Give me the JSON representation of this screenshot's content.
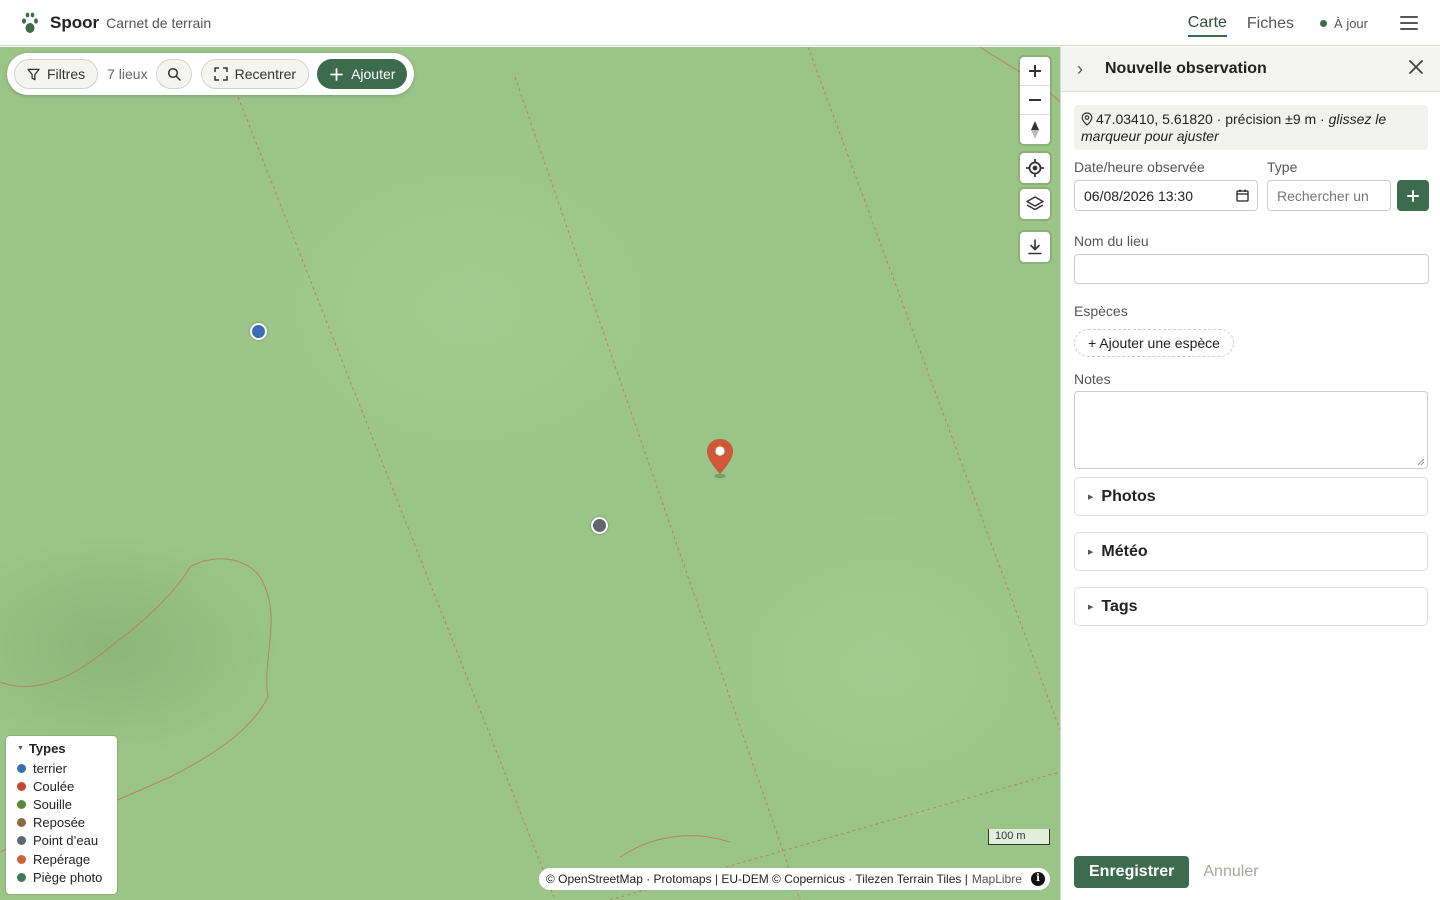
{
  "app": {
    "name": "Spoor",
    "subtitle": "Carnet de terrain"
  },
  "nav": {
    "tabs": [
      "Carte",
      "Fiches"
    ],
    "active_tab": "Carte",
    "status": "À jour"
  },
  "toolbar": {
    "filters_label": "Filtres",
    "places_count": "7 lieux",
    "recenter_label": "Recentrer",
    "add_label": "Ajouter"
  },
  "map": {
    "scale_label": "100 m",
    "attribution": "© OpenStreetMap · Protomaps | EU-DEM © Copernicus · Tilezen Terrain Tiles |",
    "attribution_link": "MapLibre",
    "markers": [
      {
        "type": "terrier",
        "color": "#3a6db3"
      },
      {
        "type": "Point d’eau",
        "color": "#5f6670"
      }
    ],
    "pin_color": "#d0573a"
  },
  "legend": {
    "title": "Types",
    "items": [
      {
        "label": "terrier",
        "color": "#3a6db3"
      },
      {
        "label": "Coulée",
        "color": "#c4472f"
      },
      {
        "label": "Souille",
        "color": "#5b8a3a"
      },
      {
        "label": "Reposée",
        "color": "#8a6a3f"
      },
      {
        "label": "Point d’eau",
        "color": "#5f6670"
      },
      {
        "label": "Repérage",
        "color": "#d0603a"
      },
      {
        "label": "Piège photo",
        "color": "#3f7a5e"
      }
    ]
  },
  "panel": {
    "title": "Nouvelle observation",
    "coords": "47.03410, 5.61820 · précision ±9 m · ",
    "coords_hint": "glissez le marqueur pour ajuster",
    "date_label": "Date/heure observée",
    "date_value": "06/08/2026 13:30",
    "type_label": "Type",
    "type_placeholder": "Rechercher un",
    "place_label": "Nom du lieu",
    "place_value": "",
    "species_label": "Espèces",
    "species_add": "+ Ajouter une espèce",
    "notes_label": "Notes",
    "notes_value": "",
    "sections": [
      "Photos",
      "Météo",
      "Tags"
    ],
    "save_label": "Enregistrer",
    "cancel_label": "Annuler"
  },
  "colors": {
    "accent": "#3d6b4d",
    "map_bg": "#9bc587"
  }
}
